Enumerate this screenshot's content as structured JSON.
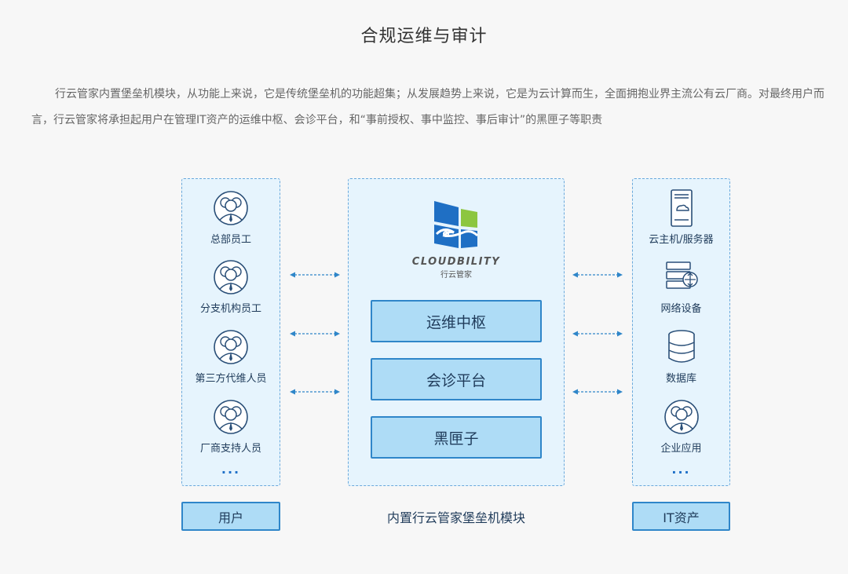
{
  "title": "合规运维与审计",
  "description": "行云管家内置堡垒机模块，从功能上来说，它是传统堡垒机的功能超集；从发展趋势上来说，它是为云计算而生，全面拥抱业界主流公有云厂商。对最终用户而言，行云管家将承担起用户在管理IT资产的运维中枢、会诊平台，和“事前授权、事中监控、事后审计”的黑匣子等职责",
  "left": {
    "items": [
      {
        "label": "总部员工",
        "icon": "user-group-icon"
      },
      {
        "label": "分支机构员工",
        "icon": "user-group-icon"
      },
      {
        "label": "第三方代维人员",
        "icon": "user-group-icon"
      },
      {
        "label": "厂商支持人员",
        "icon": "user-group-icon"
      }
    ],
    "more": "···",
    "footer": "用户"
  },
  "center": {
    "brand": "CLOUDBILITY",
    "brand_cn": "行云管家",
    "boxes": [
      "运维中枢",
      "会诊平台",
      "黑匣子"
    ],
    "caption": "内置行云管家堡垒机模块"
  },
  "right": {
    "items": [
      {
        "label": "云主机/服务器",
        "icon": "cloud-server-icon"
      },
      {
        "label": "网络设备",
        "icon": "network-device-icon"
      },
      {
        "label": "数据库",
        "icon": "database-icon"
      },
      {
        "label": "企业应用",
        "icon": "user-group-icon"
      }
    ],
    "more": "···",
    "footer": "IT资产"
  },
  "colors": {
    "accent": "#2f86c9",
    "box_fill": "#aedcf6",
    "panel_fill": "#e6f4fd",
    "logo_blue": "#1f6fc4",
    "logo_green": "#8cc63f"
  }
}
